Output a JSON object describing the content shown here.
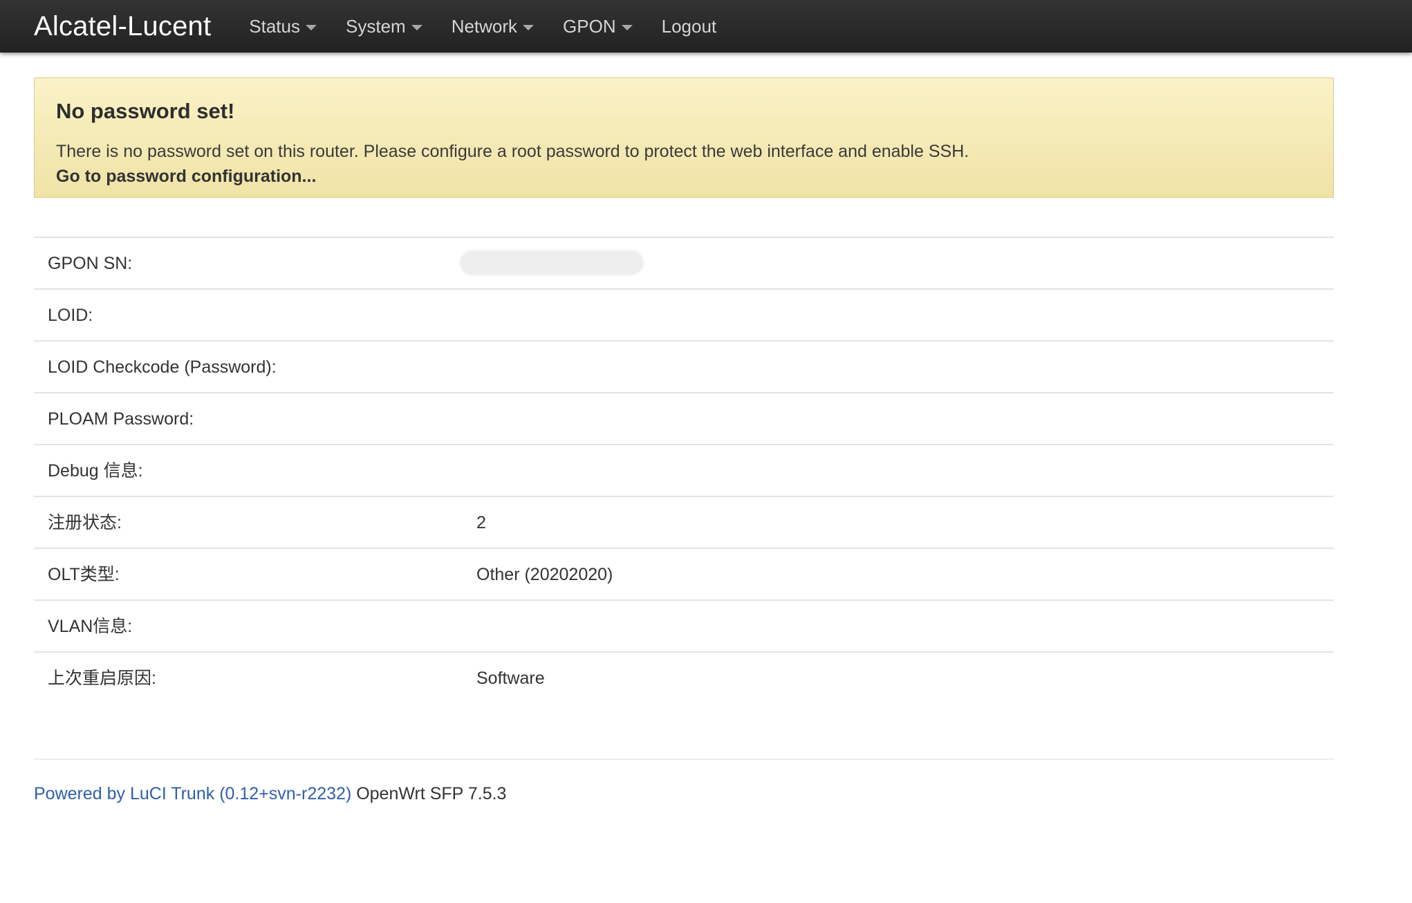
{
  "navbar": {
    "brand": "Alcatel-Lucent",
    "items": [
      {
        "label": "Status",
        "dropdown": true
      },
      {
        "label": "System",
        "dropdown": true
      },
      {
        "label": "Network",
        "dropdown": true
      },
      {
        "label": "GPON",
        "dropdown": true
      },
      {
        "label": "Logout",
        "dropdown": false
      }
    ]
  },
  "alert": {
    "title": "No password set!",
    "message": "There is no password set on this router. Please configure a root password to protect the web interface and enable SSH.",
    "link": "Go to password configuration..."
  },
  "info": {
    "rows": [
      {
        "label": "GPON SN:",
        "value": ""
      },
      {
        "label": "LOID:",
        "value": ""
      },
      {
        "label": "LOID Checkcode (Password):",
        "value": ""
      },
      {
        "label": "PLOAM Password:",
        "value": ""
      },
      {
        "label": "Debug 信息:",
        "value": ""
      },
      {
        "label": "注册状态:",
        "value": "2"
      },
      {
        "label": "OLT类型:",
        "value": "Other (20202020)"
      },
      {
        "label": "VLAN信息:",
        "value": ""
      },
      {
        "label": "上次重启原因:",
        "value": "Software"
      }
    ]
  },
  "footer": {
    "link": "Powered by LuCI Trunk (0.12+svn-r2232)",
    "text": " OpenWrt SFP 7.5.3"
  },
  "colors": {
    "navbar": "#222222",
    "alert_bg": "#f5eab8",
    "link": "#2f5fa8"
  }
}
